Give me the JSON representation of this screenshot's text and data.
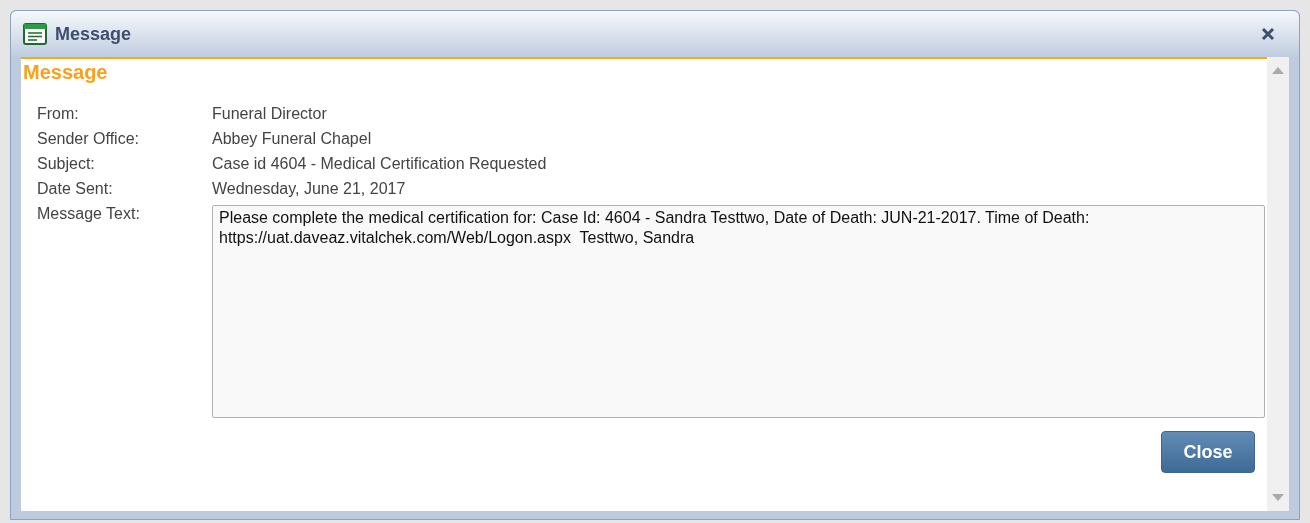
{
  "window": {
    "title": "Message"
  },
  "heading": "Message",
  "fields": [
    {
      "label": "From:",
      "value": "Funeral Director"
    },
    {
      "label": "Sender Office:",
      "value": "Abbey Funeral Chapel"
    },
    {
      "label": "Subject:",
      "value": "Case id 4604 - Medical Certification Requested"
    },
    {
      "label": "Date Sent:",
      "value": "Wednesday, June 21, 2017"
    }
  ],
  "message": {
    "label": "Message Text:",
    "value": "Please complete the medical certification for: Case Id: 4604 - Sandra Testtwo, Date of Death: JUN-21-2017. Time of Death: https://uat.daveaz.vitalchek.com/Web/Logon.aspx  Testtwo, Sandra"
  },
  "buttons": [
    "Close"
  ]
}
